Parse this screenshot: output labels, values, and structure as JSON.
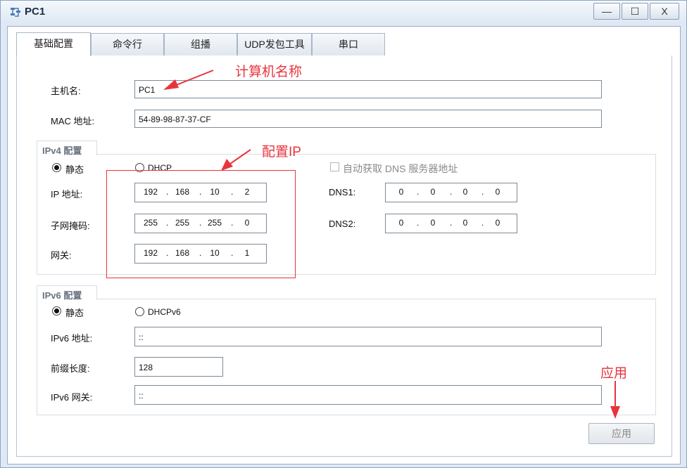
{
  "window": {
    "title": "PC1",
    "minimize": "—",
    "maximize": "☐",
    "close": "X"
  },
  "tabs": [
    "基础配置",
    "命令行",
    "组播",
    "UDP发包工具",
    "串口"
  ],
  "basic": {
    "hostname_label": "主机名:",
    "hostname_value": "PC1",
    "mac_label": "MAC 地址:",
    "mac_value": "54-89-98-87-37-CF"
  },
  "ipv4": {
    "title": "IPv4 配置",
    "static_label": "静态",
    "dhcp_label": "DHCP",
    "auto_dns_label": "自动获取 DNS 服务器地址",
    "ip_label": "IP 地址:",
    "ip": [
      "192",
      "168",
      "10",
      "2"
    ],
    "mask_label": "子网掩码:",
    "mask": [
      "255",
      "255",
      "255",
      "0"
    ],
    "gateway_label": "网关:",
    "gateway": [
      "192",
      "168",
      "10",
      "1"
    ],
    "dns1_label": "DNS1:",
    "dns1": [
      "0",
      "0",
      "0",
      "0"
    ],
    "dns2_label": "DNS2:",
    "dns2": [
      "0",
      "0",
      "0",
      "0"
    ]
  },
  "ipv6": {
    "title": "IPv6 配置",
    "static_label": "静态",
    "dhcp_label": "DHCPv6",
    "addr_label": "IPv6 地址:",
    "addr_value": "::",
    "prefix_label": "前缀长度:",
    "prefix_value": "128",
    "gateway_label": "IPv6 网关:",
    "gateway_value": "::"
  },
  "apply_label": "应用",
  "annotations": {
    "hostname": "计算机名称",
    "ip_config": "配置IP",
    "apply": "应用",
    "color": "#e8343c"
  }
}
